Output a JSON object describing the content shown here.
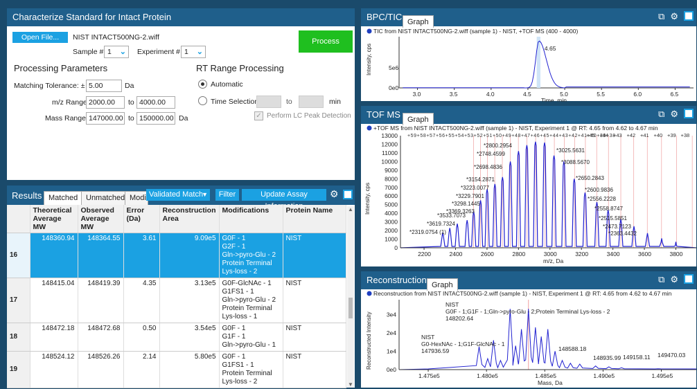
{
  "char_panel": {
    "title": "Characterize Standard for Intact Protein",
    "open_file_label": "Open File...",
    "file_name": "NIST INTACT500NG-2.wiff",
    "sample_label": "Sample #",
    "sample_value": "1",
    "experiment_label": "Experiment #",
    "experiment_value": "1",
    "process_label": "Process",
    "processing_params_heading": "Processing Parameters",
    "matching_tolerance_label": "Matching Tolerance: ±",
    "matching_tolerance_value": "5.00",
    "matching_tolerance_unit": "Da",
    "mz_range_label": "m/z Range:",
    "mz_from": "2000.00",
    "mz_to": "4000.00",
    "to_label": "to",
    "mass_range_label": "Mass Range:",
    "mass_from": "147000.00",
    "mass_to": "150000.00",
    "mass_unit": "Da",
    "rt_heading": "RT Range Processing",
    "automatic_label": "Automatic",
    "time_selection_label": "Time Selection",
    "time_unit": "min",
    "lc_peak_label": "Perform LC Peak Detection"
  },
  "results": {
    "title": "Results",
    "tabs": [
      "Matched",
      "Unmatched",
      "Modi"
    ],
    "validated_match_label": "Validated Match",
    "filter_label": "Filter",
    "update_assay_label": "Update Assay Information",
    "columns": [
      "Theoretical Average MW",
      "Observed Average MW",
      "Error (Da)",
      "Reconstruction Area",
      "Modifications",
      "Protein Name"
    ],
    "rows": [
      {
        "idx": "16",
        "theo": "148360.94",
        "obs": "148364.55",
        "err": "3.61",
        "area": "9.09e5",
        "mods": [
          "G0F - 1",
          "G2F - 1",
          "Gln->pyro-Glu - 2",
          "Protein Terminal Lys-loss - 2"
        ],
        "protein": "NIST",
        "selected": true
      },
      {
        "idx": "17",
        "theo": "148415.04",
        "obs": "148419.39",
        "err": "4.35",
        "area": "3.13e5",
        "mods": [
          "G0F-GlcNAc - 1",
          "G1FS1 - 1",
          "Gln->pyro-Glu - 2",
          "Protein Terminal Lys-loss - 1"
        ],
        "protein": "NIST",
        "selected": false
      },
      {
        "idx": "18",
        "theo": "148472.18",
        "obs": "148472.68",
        "err": "0.50",
        "area": "3.54e5",
        "mods": [
          "G0F - 1",
          "G1F - 1",
          "Gln->pyro-Glu - 1"
        ],
        "protein": "NIST",
        "selected": false
      },
      {
        "idx": "19",
        "theo": "148524.12",
        "obs": "148526.26",
        "err": "2.14",
        "area": "5.80e5",
        "mods": [
          "G0F - 1",
          "G1FS1 - 1",
          "Protein Terminal Lys-loss - 2"
        ],
        "protein": "NIST",
        "selected": false
      }
    ]
  },
  "bpc": {
    "title": "BPC/TIC",
    "tab_label": "Graph",
    "legend": "TIC from NIST INTACT500NG-2.wiff (sample 1) - NIST, +TOF MS (400 - 4000)",
    "ylabel": "Intensity, cps",
    "xlabel": "Time, min",
    "peak_label": "4.65",
    "y_ticks": [
      "5e6",
      "0e0"
    ],
    "x_ticks": [
      "3.0",
      "3.5",
      "4.0",
      "4.5",
      "5.0",
      "5.5",
      "6.0",
      "6.5"
    ]
  },
  "tof": {
    "title": "TOF MS",
    "tab_label": "Graph",
    "legend": "+TOF MS  from NIST INTACT500NG-2.wiff (sample 1) - NIST, Experiment 1 @ RT: 4.65 from 4.62 to 4.67 min",
    "ylabel": "Intensity, cps",
    "xlabel": "m/z, Da",
    "y_ticks": [
      "13000",
      "12000",
      "11000",
      "10000",
      "9000",
      "8000",
      "7000",
      "6000",
      "5000",
      "4000",
      "3000",
      "2000",
      "1000",
      "0"
    ],
    "x_ticks": [
      "2200",
      "2400",
      "2600",
      "2800",
      "3000",
      "3200",
      "3400",
      "3600",
      "3800"
    ],
    "charge_labels": "+59+58+57+56+55+54+53+52+51+50+49+48+47+46+45+44+43+42+41+40+39+38",
    "charge_labels_right": [
      "+45",
      "+44",
      "+43",
      "+42",
      "+41",
      "+40",
      "+39",
      "+38"
    ],
    "peak_labels": [
      "*2800.2954",
      "*2748.4599",
      "*3025.5631",
      "*3088.5670",
      "*2698.4836",
      "*2650.2843",
      "*3154.2871",
      "*2600.9836",
      "*3223.0077",
      "*2556.2228",
      "*3229.7901",
      "*2558.8747",
      "*3298.1445",
      "*2515.5851",
      "*3369.3263",
      "*2473.7123",
      "*3533.7073",
      "*2363.4432",
      "*3619.7324",
      "*2319.0754 (1)"
    ]
  },
  "recon": {
    "title": "Reconstruction",
    "tab_label": "Graph",
    "legend": "Reconstruction from NIST INTACT500NG-2.wiff (sample 1) - NIST, Experiment 1 @ RT: 4.65 from 4.62 to 4.67 min",
    "ylabel": "Reconstructed Intensity",
    "xlabel": "Mass, Da",
    "y_ticks": [
      "3e4",
      "2e4",
      "1e4",
      "0e0"
    ],
    "x_ticks": [
      "1.475e5",
      "1.480e5",
      "1.485e5",
      "1.490e5",
      "1.495e5"
    ],
    "annot1_lines": [
      "NIST",
      "G0F - 1;G1F - 1;Gln->pyro-Glu - 2;Protein Terminal Lys-loss - 2",
      "148202.64"
    ],
    "annot2_lines": [
      "NIST",
      "G0-HexNAc - 1;G1F-GlcNAc - 1",
      "147936.59"
    ],
    "small_labels": [
      "148588.18",
      "148935.99",
      "149158.11",
      "149470.03"
    ]
  },
  "colors": {
    "accent": "#1ba1e2",
    "header": "#1f5f8b",
    "trace": "#2020d0",
    "green": "#1fbf1f"
  }
}
